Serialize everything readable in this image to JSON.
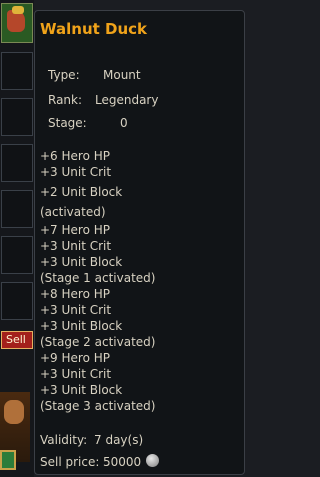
{
  "tooltip": {
    "title": "Walnut Duck",
    "type_label": "Type:",
    "type_value": "Mount",
    "rank_label": "Rank:",
    "rank_value": "Legendary",
    "stage_label": "Stage:",
    "stage_value": "0",
    "stats": [
      "+6 Hero HP",
      "+3 Unit Crit",
      "+2 Unit Block",
      "(activated)",
      "+7 Hero HP",
      "+3 Unit Crit",
      "+3 Unit Block",
      "(Stage 1 activated)",
      "+8 Hero HP",
      "+3 Unit Crit",
      "+3 Unit Block",
      "(Stage 2 activated)",
      "+9 Hero HP",
      "+3 Unit Crit",
      "+3 Unit Block",
      "(Stage 3 activated)"
    ],
    "validity_label": "Validity:",
    "validity_value": "7 day(s)",
    "sell_price_label": "Sell price:",
    "sell_price_value": "50000",
    "coin_icon": "silver-coin-icon"
  },
  "left_panel": {
    "sell_button_label": "Sell"
  }
}
